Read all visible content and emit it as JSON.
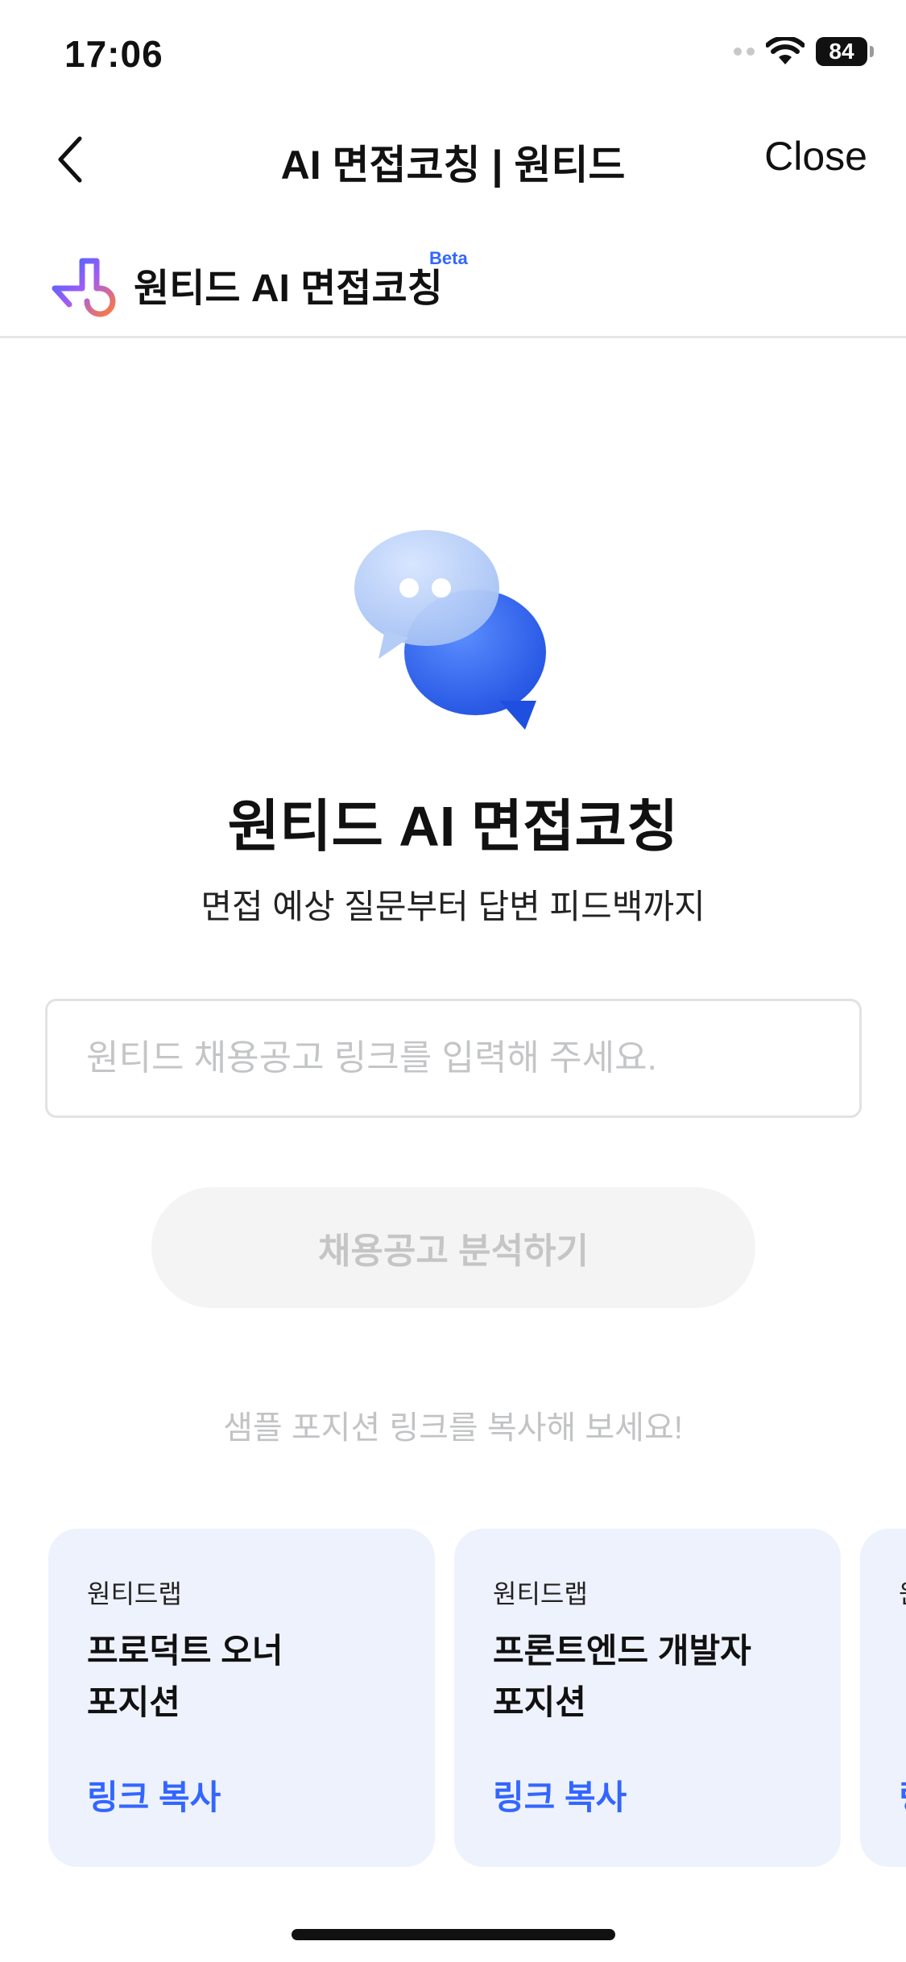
{
  "status_bar": {
    "time": "17:06",
    "battery": "84"
  },
  "nav": {
    "title": "AI 면접코칭 | 원티드",
    "close_label": "Close"
  },
  "brand": {
    "name": "원티드 AI 면접코칭",
    "badge": "Beta"
  },
  "hero": {
    "title": "원티드 AI 면접코칭",
    "subtitle": "면접 예상 질문부터 답변 피드백까지"
  },
  "form": {
    "input_placeholder": "원티드 채용공고 링크를 입력해 주세요.",
    "input_value": "",
    "submit_label": "채용공고 분석하기"
  },
  "samples": {
    "hint": "샘플 포지션 링크를 복사해 보세요!",
    "cards": [
      {
        "company": "원티드랩",
        "title_line1": "프로덕트 오너",
        "title_line2": "포지션",
        "link_label": "링크 복사"
      },
      {
        "company": "원티드랩",
        "title_line1": "프론트엔드 개발자",
        "title_line2": "포지션",
        "link_label": "링크 복사"
      },
      {
        "company": "원티드랩",
        "title_line1": "",
        "title_line2": "",
        "link_label": "링크 복사"
      }
    ]
  },
  "colors": {
    "accent": "#3366ff",
    "card_bg": "#eef2fd",
    "disabled_button_bg": "#f4f4f4"
  }
}
